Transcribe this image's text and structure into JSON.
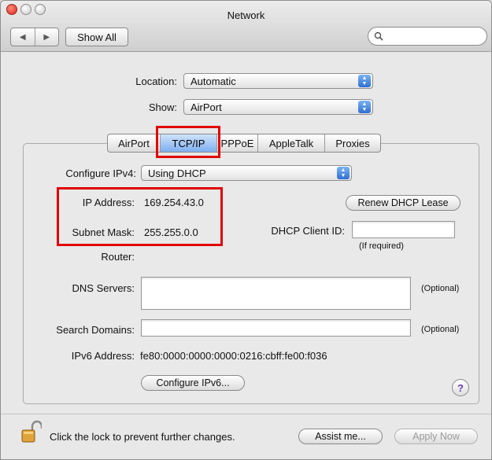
{
  "window": {
    "title": "Network"
  },
  "toolbar": {
    "back_icon": "◀",
    "forward_icon": "▶",
    "show_all_label": "Show All",
    "search_placeholder": ""
  },
  "location": {
    "label": "Location:",
    "value": "Automatic"
  },
  "show": {
    "label": "Show:",
    "value": "AirPort"
  },
  "tabs": [
    {
      "label": "AirPort",
      "selected": false
    },
    {
      "label": "TCP/IP",
      "selected": true
    },
    {
      "label": "PPPoE",
      "selected": false
    },
    {
      "label": "AppleTalk",
      "selected": false
    },
    {
      "label": "Proxies",
      "selected": false
    }
  ],
  "tcpip": {
    "configure_label": "Configure IPv4:",
    "configure_value": "Using DHCP",
    "ip_label": "IP Address:",
    "ip_value": "169.254.43.0",
    "subnet_label": "Subnet Mask:",
    "subnet_value": "255.255.0.0",
    "router_label": "Router:",
    "renew_button": "Renew DHCP Lease",
    "dhcp_client_label": "DHCP Client ID:",
    "dhcp_client_value": "",
    "if_required": "(If required)",
    "dns_label": "DNS Servers:",
    "dns_optional": "(Optional)",
    "search_domains_label": "Search Domains:",
    "search_optional": "(Optional)",
    "ipv6_label": "IPv6 Address:",
    "ipv6_value": "fe80:0000:0000:0000:0216:cbff:fe00:f036",
    "configure_ipv6_button": "Configure IPv6...",
    "help_glyph": "?"
  },
  "footer": {
    "lock_text": "Click the lock to prevent further changes.",
    "assist_button": "Assist me...",
    "apply_button": "Apply Now"
  },
  "colors": {
    "highlight_box": "#e00000",
    "selected_tab": "#7eaef0",
    "popup_arrow": "#2f6fd0"
  }
}
